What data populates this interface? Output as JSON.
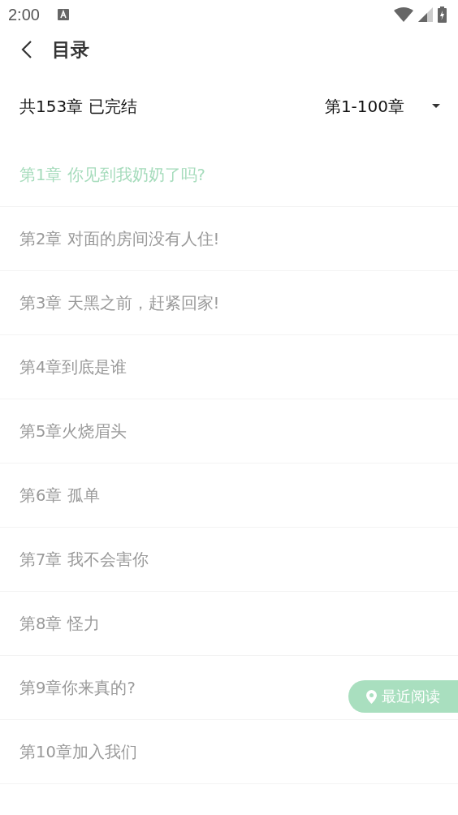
{
  "status_bar": {
    "time": "2:00"
  },
  "header": {
    "title": "目录"
  },
  "summary": {
    "info": "共153章 已完结",
    "range": "第1-100章"
  },
  "chapters": [
    {
      "title": "第1章 你见到我奶奶了吗?",
      "selected": true
    },
    {
      "title": "第2章 对面的房间没有人住!",
      "selected": false
    },
    {
      "title": "第3章 天黑之前，赶紧回家!",
      "selected": false
    },
    {
      "title": "第4章到底是谁",
      "selected": false
    },
    {
      "title": "第5章火烧眉头",
      "selected": false
    },
    {
      "title": "第6章 孤单",
      "selected": false
    },
    {
      "title": "第7章 我不会害你",
      "selected": false
    },
    {
      "title": "第8章 怪力",
      "selected": false
    },
    {
      "title": "第9章你来真的?",
      "selected": false
    },
    {
      "title": "第10章加入我们",
      "selected": false
    }
  ],
  "recent_button": {
    "label": "最近阅读"
  }
}
